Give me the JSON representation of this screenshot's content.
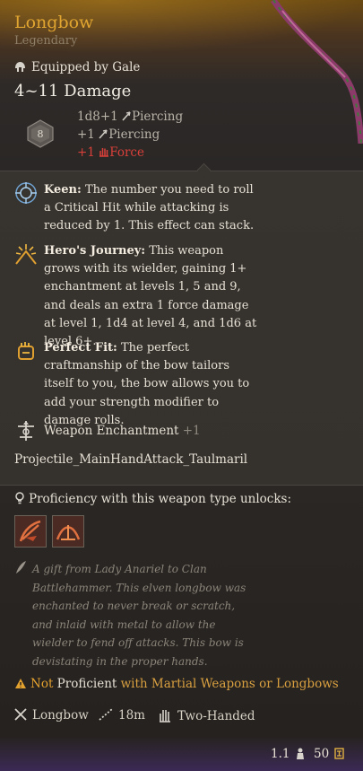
{
  "item": {
    "name": "Longbow",
    "rarity": "Legendary",
    "equipped_by": "Equipped by Gale",
    "damage_total": "4~11 Damage",
    "die_label": "8",
    "damage_lines": [
      {
        "value": "1d8+1",
        "type": "Piercing"
      },
      {
        "value": "+1",
        "type": "Piercing"
      },
      {
        "value": "+1",
        "type": "Force"
      }
    ]
  },
  "passives": [
    {
      "name": "Keen:",
      "text": "The number you need to roll a Critical Hit while attacking is reduced by 1. This effect can stack."
    },
    {
      "name": "Hero's Journey:",
      "text": "This weapon grows with its wielder, gaining 1+ enchantment at levels 1, 5 and 9, and deals an extra 1 force damage at level 1, 1d4 at level 4, and 1d6 at level 6+."
    },
    {
      "name": "Perfect Fit:",
      "text": "The perfect craftmanship of the bow tailors itself to you, the bow allows you to add your strength modifier to damage rolls."
    }
  ],
  "enchantment": {
    "label": "Weapon Enchantment",
    "value": "+1"
  },
  "projectile": "Projectile_MainHandAttack_Taulmaril",
  "proficiency": {
    "label": "Proficiency with this weapon type unlocks:"
  },
  "flavor_text": "A gift from Lady Anariel to Clan Battlehammer. This elven longbow was enchanted to never break or scratch, and inlaid with metal to allow the wielder to fend off attacks. This bow is devistating in the proper hands.",
  "warning": {
    "not": "Not",
    "proficient": "Proficient",
    "rest": "with Martial Weapons or Longbows"
  },
  "stats": {
    "weapon_type": "Longbow",
    "range": "18m",
    "handedness": "Two-Handed"
  },
  "footer": {
    "weight": "1.1",
    "value": "50"
  },
  "colors": {
    "title": "#e0a530",
    "force": "#d9403a",
    "warning": "#e3a12e"
  },
  "icons": [
    "helmet-icon",
    "d8-die-icon",
    "arrow-icon",
    "force-hand-icon",
    "keen-icon",
    "heros-journey-icon",
    "perfect-fit-icon",
    "enchantment-icon",
    "lightbulb-icon",
    "action-icon",
    "quill-icon",
    "warning-icon",
    "crossed-swords-icon",
    "range-icon",
    "two-hand-icon",
    "weight-icon",
    "gold-icon"
  ]
}
